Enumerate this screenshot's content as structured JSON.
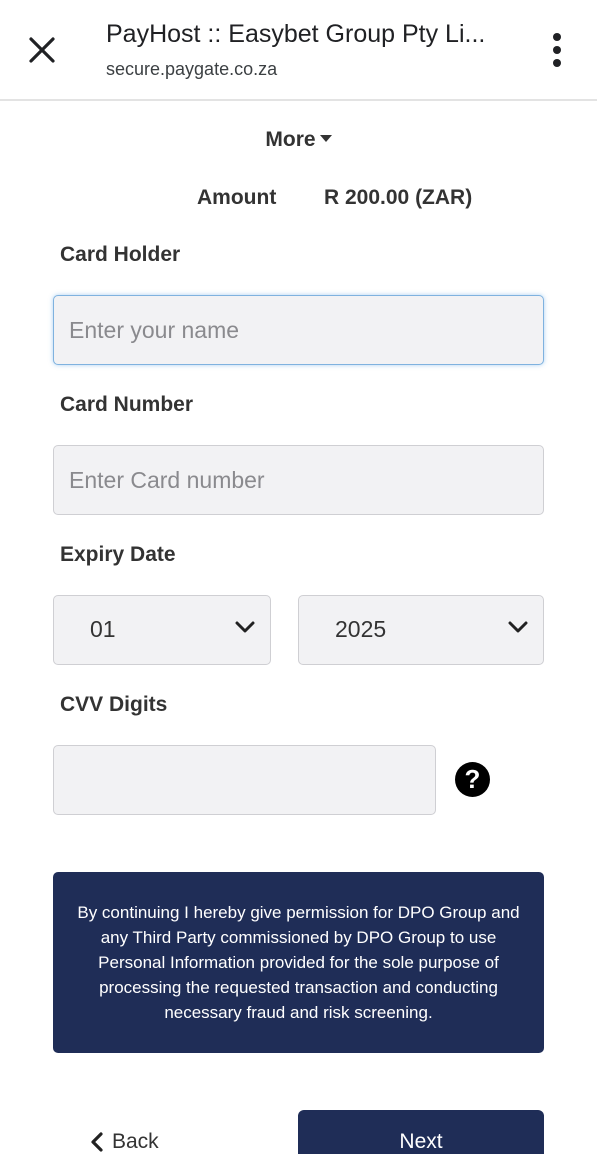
{
  "browser": {
    "title": "PayHost :: Easybet Group Pty Li...",
    "url": "secure.paygate.co.za"
  },
  "header": {
    "more_label": "More"
  },
  "amount": {
    "label": "Amount",
    "value": "R 200.00 (ZAR)"
  },
  "form": {
    "card_holder": {
      "label": "Card Holder",
      "placeholder": "Enter your name",
      "value": ""
    },
    "card_number": {
      "label": "Card Number",
      "placeholder": "Enter Card number",
      "value": ""
    },
    "expiry": {
      "label": "Expiry Date",
      "month": "01",
      "year": "2025"
    },
    "cvv": {
      "label": "CVV Digits",
      "placeholder": "",
      "value": ""
    }
  },
  "consent_text": "By continuing I hereby give permission for DPO Group and any Third Party commissioned by DPO Group to use Personal Information provided for the sole purpose of processing the requested transaction and conducting necessary fraud and risk screening.",
  "actions": {
    "back_label": "Back",
    "next_label": "Next"
  },
  "icons": {
    "close": "close-icon",
    "menu": "more-vert-icon",
    "caret": "caret-down-icon",
    "chevron": "chevron-down-icon",
    "help": "question-circle-icon",
    "back": "chevron-left-icon"
  },
  "colors": {
    "primary": "#1f2d57",
    "input_bg": "#f2f2f4",
    "focus_border": "#7fb2df"
  }
}
